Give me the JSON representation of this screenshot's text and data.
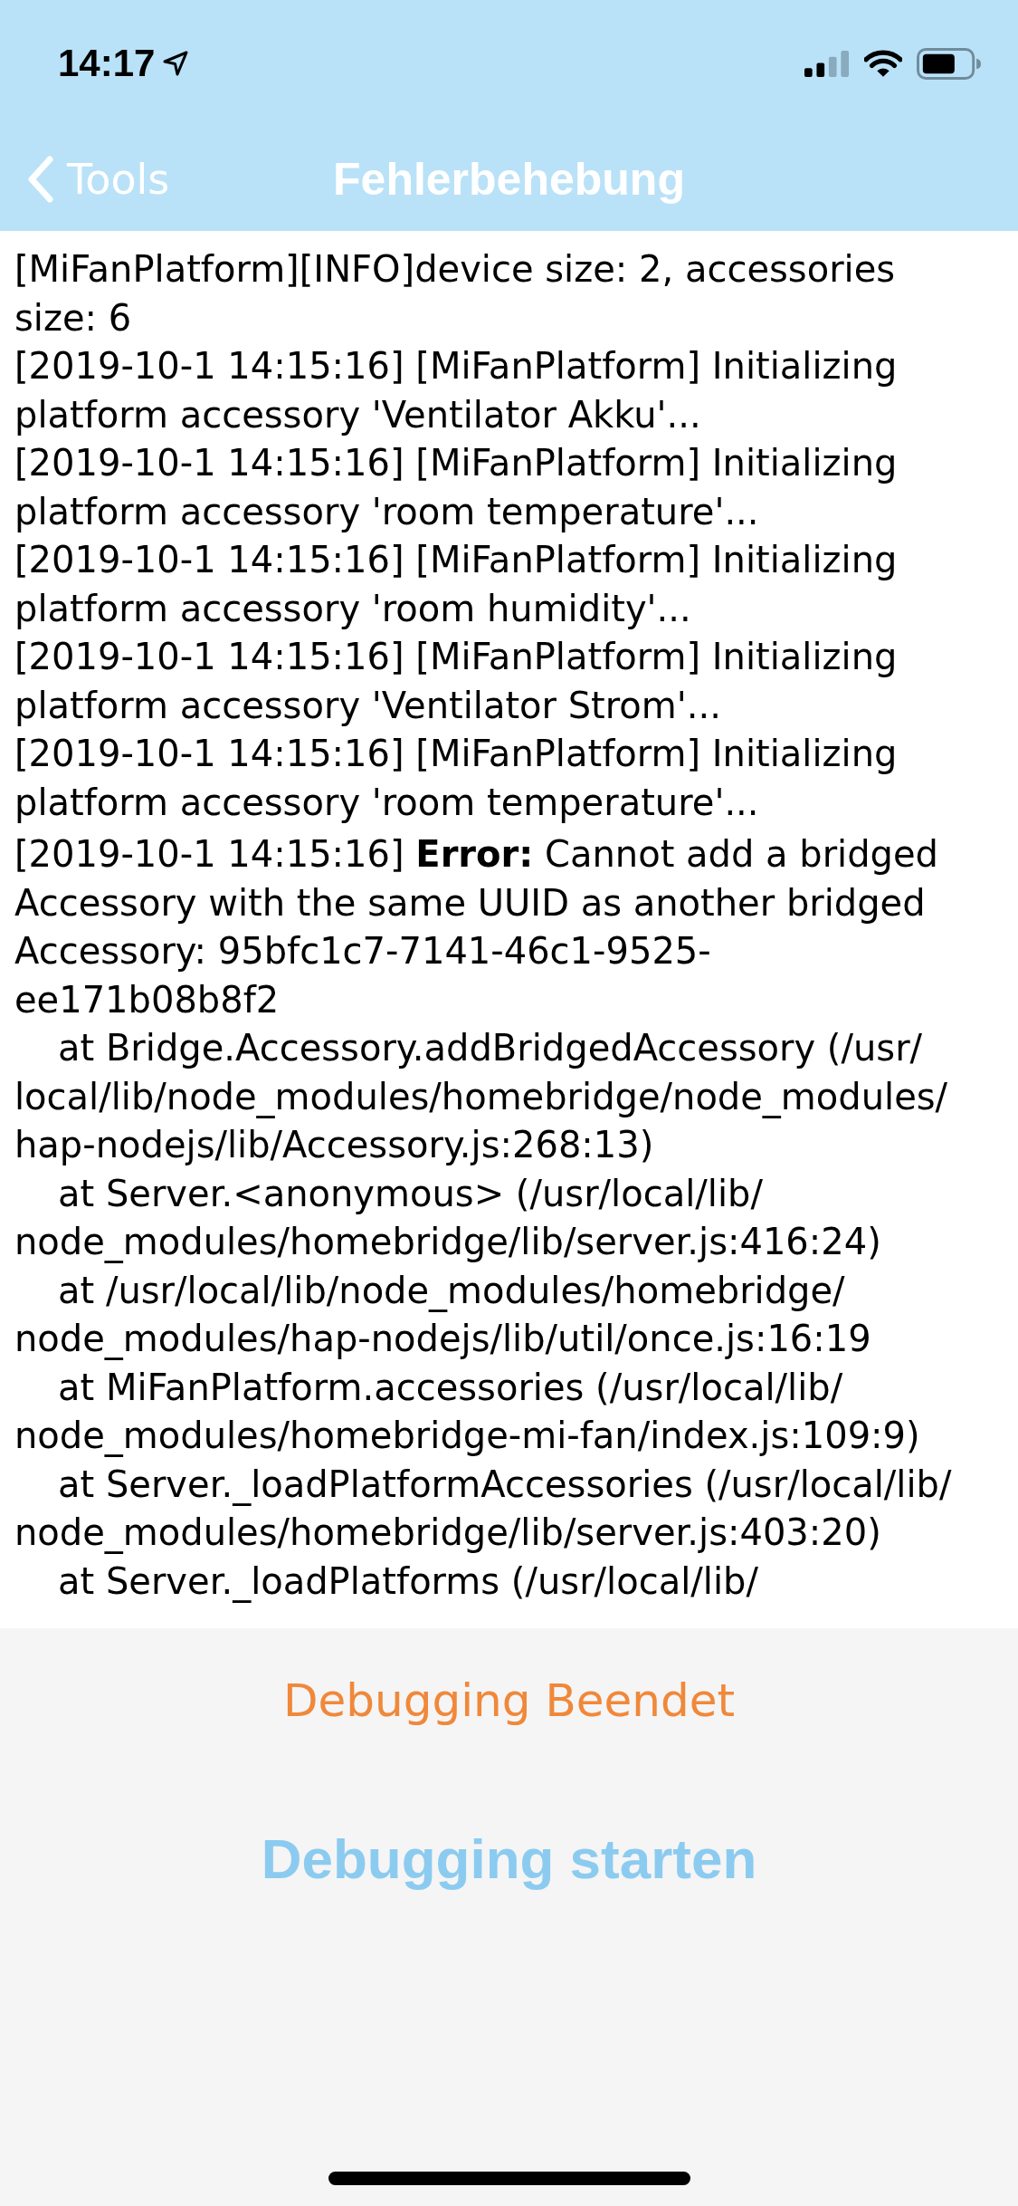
{
  "status_bar": {
    "time": "14:17"
  },
  "nav_bar": {
    "back_label": "Tools",
    "title": "Fehlerbehebung"
  },
  "log": {
    "entries": [
      {
        "kind": "message",
        "text": "[MiFanPlatform][INFO]device size: 2, accessories size: 6"
      },
      {
        "kind": "message",
        "text": "[2019-10-1 14:15:16] [MiFanPlatform] Initializing platform accessory 'Ventilator Akku'..."
      },
      {
        "kind": "message",
        "text": "[2019-10-1 14:15:16] [MiFanPlatform] Initializing platform accessory 'room temperature'..."
      },
      {
        "kind": "message",
        "text": "[2019-10-1 14:15:16] [MiFanPlatform] Initializing platform accessory 'room humidity'..."
      },
      {
        "kind": "message",
        "text": "[2019-10-1 14:15:16] [MiFanPlatform] Initializing platform accessory 'Ventilator Strom'..."
      },
      {
        "kind": "message",
        "text": "[2019-10-1 14:15:16] [MiFanPlatform] Initializing platform accessory 'room temperature'..."
      },
      {
        "kind": "error",
        "text": "[2019-10-1 14:15:16] **Error:** Cannot add a bridged Accessory with the same UUID as another bridged Accessory: 95bfc1c7-7141-46c1-9525-ee171b08b8f2"
      },
      {
        "kind": "stack",
        "text": "at Bridge.Accessory.addBridgedAccessory (/usr/local/lib/node_modules/homebridge/node_modules/hap-nodejs/lib/Accessory.js:268:13)"
      },
      {
        "kind": "stack",
        "text": "at Server.<anonymous> (/usr/local/lib/node_modules/homebridge/lib/server.js:416:24)"
      },
      {
        "kind": "stack",
        "text": "at /usr/local/lib/node_modules/homebridge/node_modules/hap-nodejs/lib/util/once.js:16:19"
      },
      {
        "kind": "stack",
        "text": "at MiFanPlatform.accessories (/usr/local/lib/node_modules/homebridge-mi-fan/index.js:109:9)"
      },
      {
        "kind": "stack",
        "text": "at Server._loadPlatformAccessories (/usr/local/lib/node_modules/homebridge/lib/server.js:403:20)"
      },
      {
        "kind": "stack",
        "text": "at Server._loadPlatforms (/usr/local/lib/"
      }
    ]
  },
  "buttons": [
    {
      "kind": "stop",
      "label": "Debugging Beendet",
      "disabled": false
    },
    {
      "kind": "start",
      "label": "Debugging starten",
      "disabled": true
    }
  ]
}
